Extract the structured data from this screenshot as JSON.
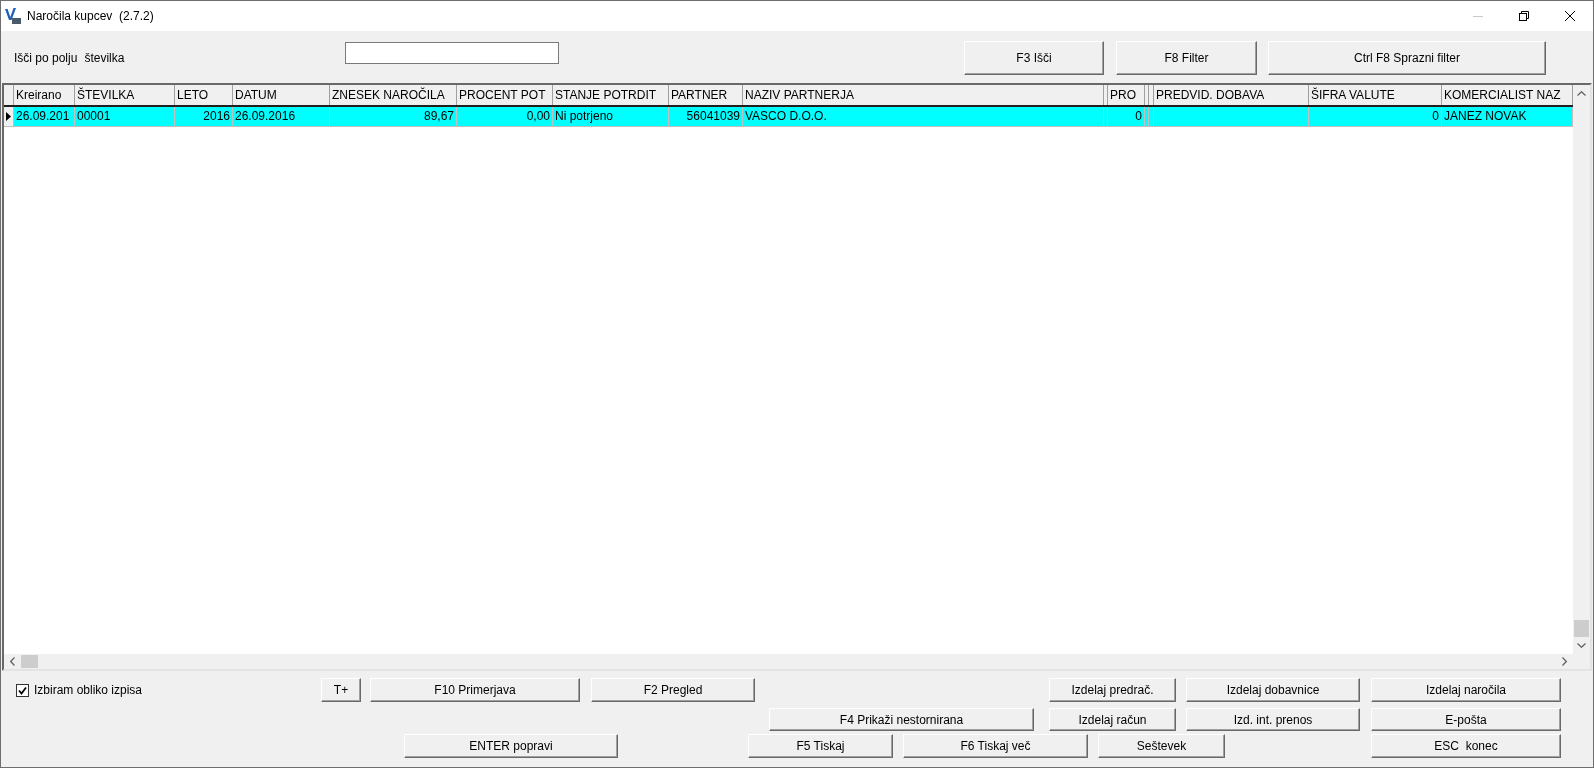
{
  "window": {
    "title": "Naročila kupcev  (2.7.2)",
    "minimize": {
      "disabled": true
    }
  },
  "search": {
    "label": "Išči po polju",
    "field": "številka"
  },
  "search_buttons": [
    "F3 Išči",
    "F8 Filter",
    "Ctrl F8 Sprazni filter"
  ],
  "table": {
    "columns": [
      {
        "label": "Kreirano",
        "kind": "text"
      },
      {
        "label": "ŠTEVILKA",
        "kind": "text"
      },
      {
        "label": "LETO",
        "kind": "number"
      },
      {
        "label": "DATUM",
        "kind": "text"
      },
      {
        "label": "ZNESEK NAROČILA",
        "kind": "number"
      },
      {
        "label": "PROCENT POT",
        "kind": "number"
      },
      {
        "label": "STANJE POTRDIT",
        "kind": "text"
      },
      {
        "label": "PARTNER",
        "kind": "number"
      },
      {
        "label": "NAZIV PARTNERJA",
        "kind": "text"
      },
      {
        "kind": "blank"
      },
      {
        "label": "PRO",
        "kind": "number"
      },
      {
        "kind": "blank"
      },
      {
        "kind": "blank"
      },
      {
        "label": "PREDVID. DOBAVA",
        "kind": "text"
      },
      {
        "label": "ŠIFRA VALUTE",
        "kind": "number"
      },
      {
        "label": "KOMERCIALIST NAZ",
        "kind": "text"
      }
    ],
    "rows": [
      {
        "selected": true,
        "cells": [
          "26.09.201",
          "00001",
          "2016",
          "26.09.2016",
          "89,67",
          "0,00",
          "Ni potrjeno",
          "56041039",
          "VASCO D.O.O.",
          null,
          "0",
          null,
          null,
          null,
          "0",
          "JANEZ NOVAK"
        ]
      }
    ]
  },
  "print_option": {
    "label": "Izbiram obliko izpisa",
    "checked": true
  },
  "button_rows": [
    [
      "T+",
      "F10 Primerjava",
      "F2 Pregled",
      "Izdelaj predrač.",
      "Izdelaj dobavnice",
      "Izdelaj naročila"
    ],
    [
      "F4 Prikaži nestornirana",
      "Izdelaj račun",
      "Izd. int. prenos",
      "E-pošta"
    ],
    [
      "ENTER popravi",
      "F5 Tiskaj",
      "F6 Tiskaj več",
      "Seštevek",
      "ESC  konec"
    ]
  ]
}
